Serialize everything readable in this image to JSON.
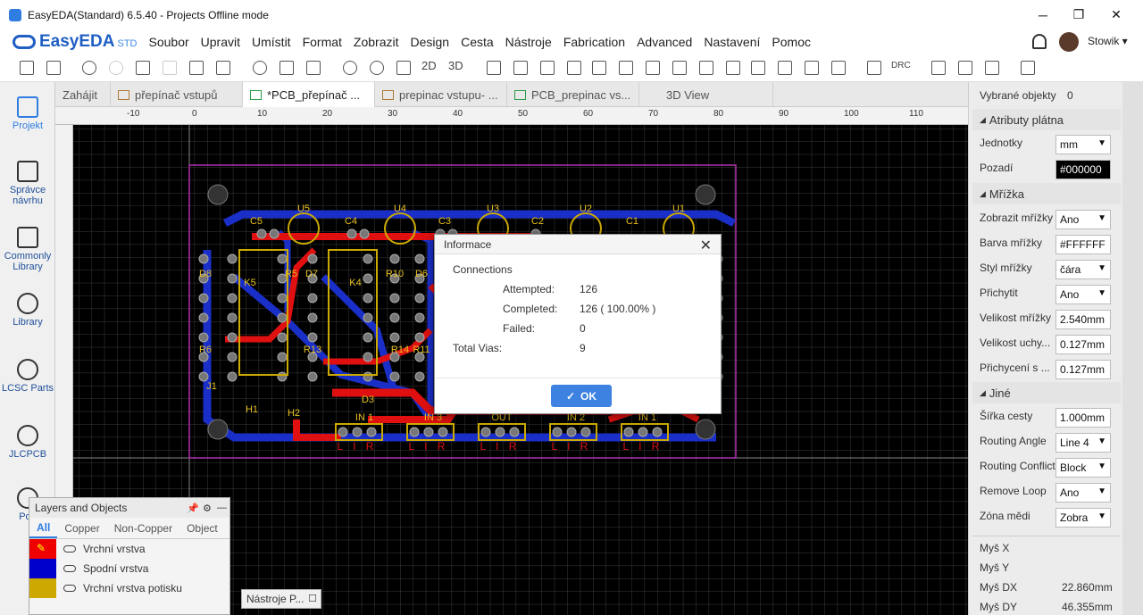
{
  "window": {
    "title": "EasyEDA(Standard) 6.5.40 - Projects Offline mode",
    "minimize": "─",
    "restore": "❐",
    "close": "✕"
  },
  "brand": {
    "name": "EasyEDA",
    "edition": "STD"
  },
  "menu": [
    "Soubor",
    "Upravit",
    "Umístit",
    "Format",
    "Zobrazit",
    "Design",
    "Cesta",
    "Nástroje",
    "Fabrication",
    "Advanced",
    "Nastavení",
    "Pomoc"
  ],
  "user": {
    "name": "Stowik ▾"
  },
  "toolbar": {
    "view2d": "2D",
    "view3d": "3D",
    "drc": "DRC"
  },
  "leftbar": [
    {
      "label": "Projekt",
      "icon": "folder-icon"
    },
    {
      "label": "Správce návrhu",
      "icon": "design-manager-icon"
    },
    {
      "label": "Commonly Library",
      "icon": "chip-icon"
    },
    {
      "label": "Library",
      "icon": "library-search-icon"
    },
    {
      "label": "LCSC Parts",
      "icon": "lcsc-icon"
    },
    {
      "label": "JLCPCB",
      "icon": "jlcpcb-icon"
    },
    {
      "label": "Pod",
      "icon": "help-icon"
    }
  ],
  "tabs": [
    {
      "label": "Zahájit"
    },
    {
      "label": "přepínač vstupů"
    },
    {
      "label": "*PCB_přepínač ..."
    },
    {
      "label": "prepinac vstupu- ..."
    },
    {
      "label": "PCB_prepinac vs..."
    },
    {
      "label": "3D View"
    }
  ],
  "ruler": [
    "-10",
    "0",
    "10",
    "20",
    "30",
    "40",
    "50",
    "60",
    "70",
    "80",
    "90",
    "100",
    "110"
  ],
  "pcb": {
    "designators": [
      "U5",
      "U4",
      "U3",
      "U2",
      "U1",
      "C5",
      "C4",
      "C3",
      "C2",
      "C1",
      "K5",
      "K4",
      "D8",
      "R5",
      "D7",
      "R10",
      "D6",
      "R6",
      "R13",
      "R14",
      "R11",
      "J1",
      "H1",
      "H2",
      "D3",
      "IN 1",
      "IN 3",
      "OUT",
      "IN 2",
      "IN 1"
    ],
    "pin_labels": "L I R"
  },
  "dialog": {
    "title": "Informace",
    "heading": "Connections",
    "rows": [
      {
        "label": "Attempted:",
        "value": "126"
      },
      {
        "label": "Completed:",
        "value": "126 ( 100.00% )"
      },
      {
        "label": "Failed:",
        "value": "0"
      }
    ],
    "vias_label": "Total Vias:",
    "vias_value": "9",
    "ok": "OK"
  },
  "layers_panel": {
    "title": "Layers and Objects",
    "tabs": [
      "All",
      "Copper",
      "Non-Copper",
      "Object"
    ],
    "layers": [
      {
        "name": "Vrchní vrstva",
        "color": "#ff0000"
      },
      {
        "name": "Spodní vrstva",
        "color": "#0000ff"
      },
      {
        "name": "Vrchní vrstva potisku",
        "color": "#ccaa00"
      }
    ]
  },
  "tools_panel": {
    "label": "Nástroje P..."
  },
  "properties": {
    "selected_label": "Vybrané objekty",
    "selected_count": "0",
    "canvas_section": "Atributy plátna",
    "units_label": "Jednotky",
    "units": "mm",
    "background_label": "Pozadí",
    "background": "#000000",
    "grid_section": "Mřížka",
    "show_grid_label": "Zobrazit mřížky",
    "show_grid": "Ano",
    "grid_color_label": "Barva mřížky",
    "grid_color": "#FFFFFF",
    "grid_style_label": "Styl mřížky",
    "grid_style": "čára",
    "snap_label": "Přichytit",
    "snap": "Ano",
    "grid_size_label": "Velikost mřížky",
    "grid_size": "2.540mm",
    "alt_snap_label": "Velikost uchy...",
    "alt_snap": "0.127mm",
    "snap_size_label": "Přichycení s ...",
    "snap_size": "0.127mm",
    "other_section": "Jiné",
    "track_width_label": "Šířka cesty",
    "track_width": "1.000mm",
    "routing_angle_label": "Routing Angle",
    "routing_angle": "Line 4",
    "routing_conflict_label": "Routing Conflict",
    "routing_conflict": "Block",
    "remove_loop_label": "Remove Loop",
    "remove_loop": "Ano",
    "copper_zone_label": "Zóna mědi",
    "copper_zone": "Zobra",
    "mouse_x_label": "Myš X",
    "mouse_y_label": "Myš Y",
    "mouse_dx_label": "Myš DX",
    "mouse_dx": "22.860mm",
    "mouse_dy_label": "Myš DY",
    "mouse_dy": "46.355mm"
  }
}
